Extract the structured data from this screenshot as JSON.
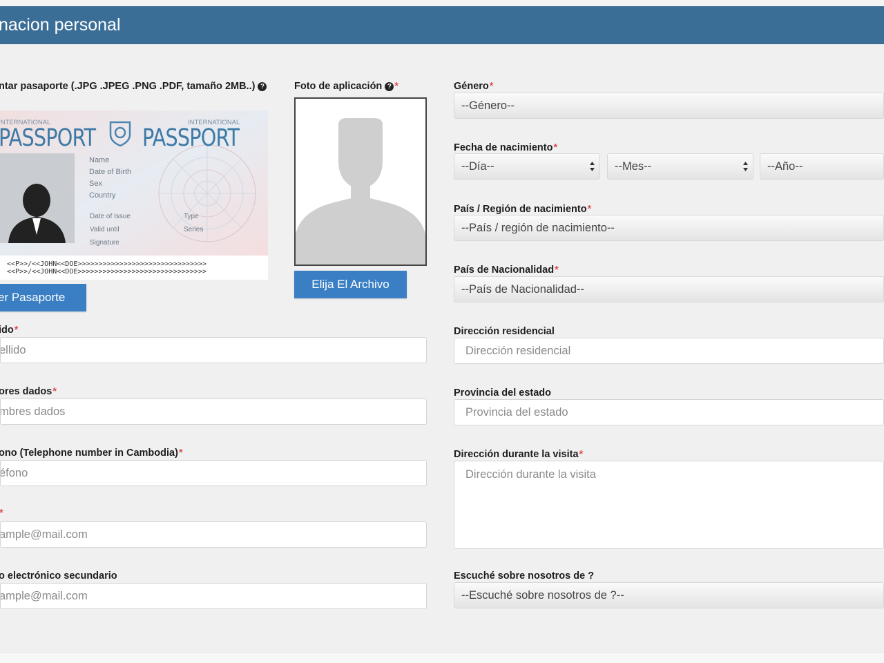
{
  "header": {
    "title": "nacion personal"
  },
  "upload_passport": {
    "label": "ntar pasaporte (.JPG .JPEG .PNG .PDF, tamaño 2MB..)",
    "button": "er Pasaporte"
  },
  "passport_image": {
    "brand_small_left": "INTERNATIONAL",
    "brand_left": "PASSPORT",
    "brand_small_right": "INTERNATIONAL",
    "brand_right": "PASSPORT",
    "fields_top": [
      "Name",
      "Date of Birth",
      "Sex",
      "Country"
    ],
    "fields_bottom_left": [
      "Date of Issue",
      "Valid until",
      "Signature"
    ],
    "fields_bottom_right": [
      "Type",
      "Series"
    ],
    "mrz_line1": "<<P>>/<<JOHN<<DOE>>>>>>>>>>>>>>>>>>>>>>>>>>>>>>>",
    "mrz_line2": "<<P>>/<<JOHN<<DOE>>>>>>>>>>>>>>>>>>>>>>>>>>>>>>>"
  },
  "app_photo": {
    "label": "Foto de aplicación",
    "button": "Elija El Archivo"
  },
  "left_fields": [
    {
      "label": "ido",
      "required": true,
      "placeholder": "ellido"
    },
    {
      "label": "ores dados",
      "required": true,
      "placeholder": "mbres dados"
    },
    {
      "label": "ono (Telephone number in Cambodia)",
      "required": true,
      "placeholder": "éfono"
    },
    {
      "label": "",
      "required": true,
      "placeholder": "ample@mail.com"
    },
    {
      "label": "o electrónico secundario",
      "required": false,
      "placeholder": "ample@mail.com"
    }
  ],
  "right": {
    "gender": {
      "label": "Género",
      "value": "--Género--"
    },
    "dob": {
      "label": "Fecha de nacimiento",
      "day": "--Día--",
      "month": "--Mes--",
      "year": "--Año--"
    },
    "birth_country": {
      "label": "País / Región de nacimiento",
      "value": "--País / región de nacimiento--"
    },
    "nationality": {
      "label": "País de Nacionalidad",
      "value": "--País de Nacionalidad--"
    },
    "address": {
      "label": "Dirección residencial",
      "placeholder": "Dirección residencial"
    },
    "province": {
      "label": "Provincia del estado",
      "placeholder": "Provincia del estado"
    },
    "visit_address": {
      "label": "Dirección durante la visita",
      "placeholder": "Dirección durante la visita"
    },
    "heard": {
      "label": "Escuché sobre nosotros de ?",
      "value": "--Escuché sobre nosotros de ?--"
    }
  },
  "required_mark": "*",
  "help_icon_glyph": "?",
  "colors": {
    "header": "#3b6e96",
    "button": "#3a7ec4",
    "required": "#d9534f"
  }
}
